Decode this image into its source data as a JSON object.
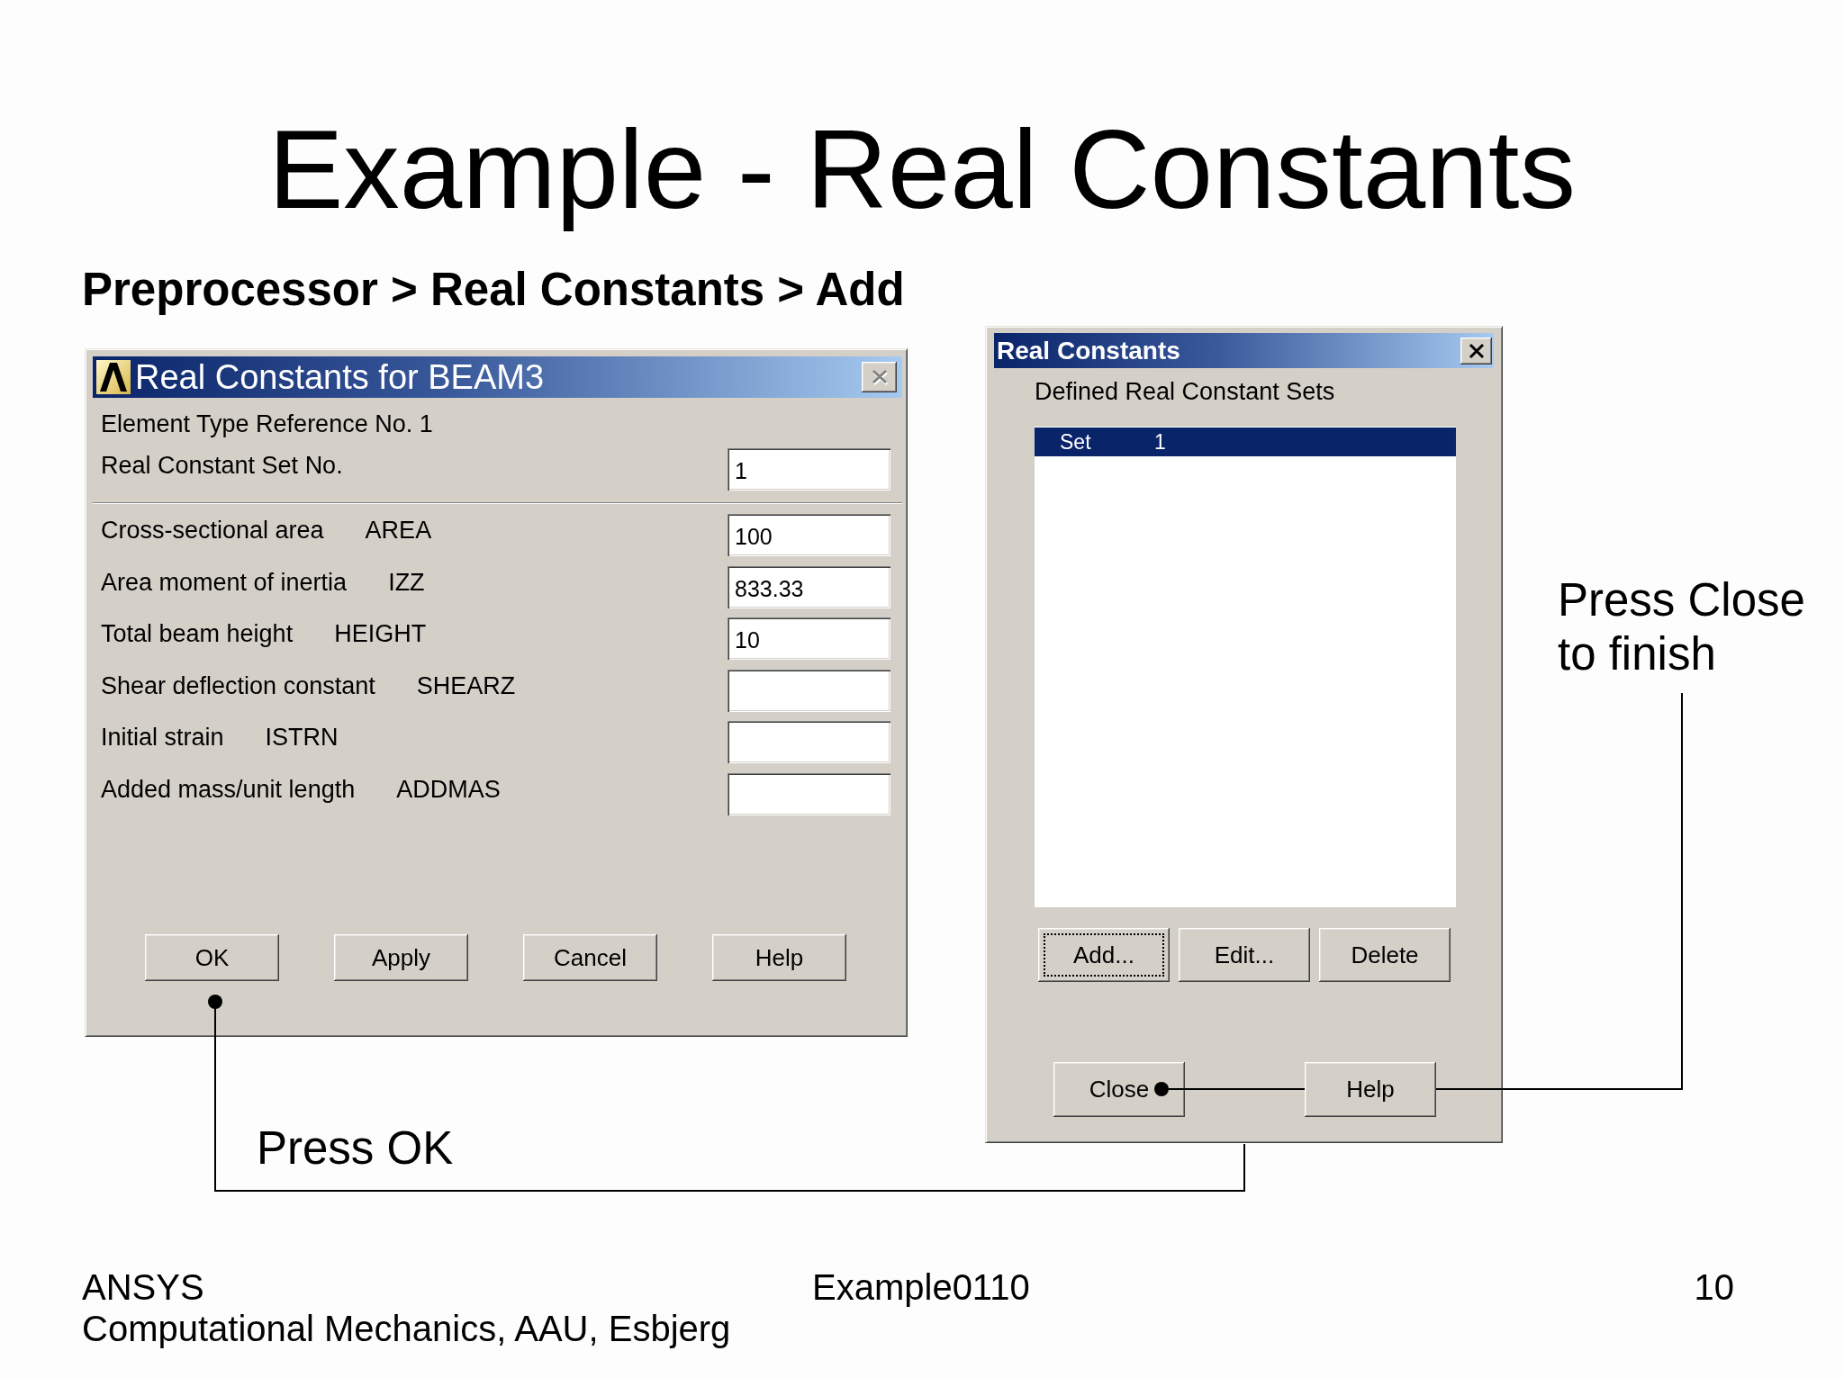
{
  "slide": {
    "title": "Example - Real Constants",
    "subtitle": "Preprocessor > Real Constants > Add"
  },
  "constants_dialog": {
    "title": "Real Constants for BEAM3",
    "close_disabled": true,
    "element_type": "Element Type Reference No. 1",
    "set_field": {
      "label": "Real Constant Set No.",
      "value": "1"
    },
    "constants": [
      {
        "label": "Cross-sectional area",
        "code": "AREA",
        "value": "100"
      },
      {
        "label": "Area moment of inertia",
        "code": "IZZ",
        "value": "833.33"
      },
      {
        "label": "Total beam height",
        "code": "HEIGHT",
        "value": "10"
      },
      {
        "label": "Shear deflection constant",
        "code": "SHEARZ"
      },
      {
        "label": "Initial strain",
        "code": "ISTRN"
      },
      {
        "label": "Added mass/unit length",
        "code": "ADDMAS"
      }
    ],
    "buttons": [
      "OK",
      "Apply",
      "Cancel",
      "Help"
    ]
  },
  "sets_dialog": {
    "title": "Real Constants",
    "close_disabled": false,
    "list_label": "Defined Real Constant Sets",
    "sets": [
      {
        "text": "Set 1",
        "selected": true
      }
    ],
    "actions": [
      {
        "label": "Add...",
        "focused": true
      },
      {
        "label": "Edit...",
        "focused": false
      },
      {
        "label": "Delete",
        "focused": false
      }
    ],
    "buttons": [
      "Close",
      "Help"
    ]
  },
  "ok_callout": "Press OK",
  "close_callout": "Press Close to finish",
  "footer": {
    "lines": [
      "ANSYS",
      "Computational Mechanics, AAU, Esbjerg"
    ],
    "center": "Example0110",
    "page_number": "10"
  }
}
